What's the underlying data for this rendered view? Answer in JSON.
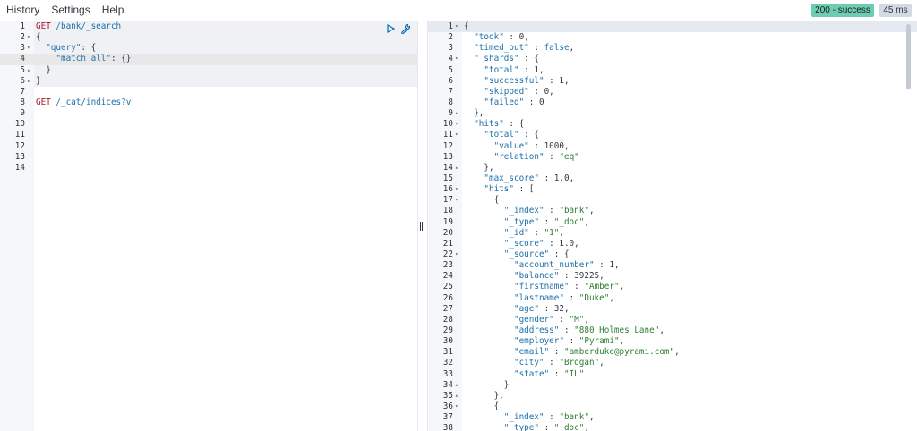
{
  "menu": {
    "history": "History",
    "settings": "Settings",
    "help": "Help"
  },
  "status": {
    "code": "200 - success",
    "time": "45 ms"
  },
  "icons": {
    "run": "play-icon",
    "wrench": "wrench-icon"
  },
  "request": {
    "lines": [
      {
        "n": "1",
        "fold": "",
        "parts": [
          [
            "method",
            "GET"
          ],
          [
            "url",
            " /bank/_search"
          ]
        ]
      },
      {
        "n": "2",
        "fold": "▾",
        "parts": [
          [
            "punc",
            "{"
          ]
        ]
      },
      {
        "n": "3",
        "fold": "▾",
        "parts": [
          [
            "punc",
            "  "
          ],
          [
            "key",
            "\"query\""
          ],
          [
            "punc",
            ": {"
          ]
        ]
      },
      {
        "n": "4",
        "fold": "",
        "parts": [
          [
            "punc",
            "    "
          ],
          [
            "key",
            "\"match_all\""
          ],
          [
            "punc",
            ": {}"
          ]
        ],
        "active": true
      },
      {
        "n": "5",
        "fold": "▴",
        "parts": [
          [
            "punc",
            "  }"
          ]
        ]
      },
      {
        "n": "6",
        "fold": "▴",
        "parts": [
          [
            "punc",
            "}"
          ]
        ]
      },
      {
        "n": "7",
        "fold": "",
        "parts": []
      },
      {
        "n": "8",
        "fold": "",
        "parts": [
          [
            "method",
            "GET"
          ],
          [
            "url",
            " /_cat/indices?v"
          ]
        ]
      },
      {
        "n": "9",
        "fold": "",
        "parts": []
      },
      {
        "n": "10",
        "fold": "",
        "parts": []
      },
      {
        "n": "11",
        "fold": "",
        "parts": []
      },
      {
        "n": "12",
        "fold": "",
        "parts": []
      },
      {
        "n": "13",
        "fold": "",
        "parts": []
      },
      {
        "n": "14",
        "fold": "",
        "parts": []
      }
    ]
  },
  "response": {
    "lines": [
      {
        "n": "1",
        "fold": "▾",
        "parts": [
          [
            "punc",
            "{"
          ]
        ],
        "active": true
      },
      {
        "n": "2",
        "fold": "",
        "parts": [
          [
            "punc",
            "  "
          ],
          [
            "key",
            "\"took\""
          ],
          [
            "punc",
            " : "
          ],
          [
            "num",
            "0"
          ],
          [
            "punc",
            ","
          ]
        ]
      },
      {
        "n": "3",
        "fold": "",
        "parts": [
          [
            "punc",
            "  "
          ],
          [
            "key",
            "\"timed_out\""
          ],
          [
            "punc",
            " : "
          ],
          [
            "bool",
            "false"
          ],
          [
            "punc",
            ","
          ]
        ]
      },
      {
        "n": "4",
        "fold": "▾",
        "parts": [
          [
            "punc",
            "  "
          ],
          [
            "key",
            "\"_shards\""
          ],
          [
            "punc",
            " : {"
          ]
        ]
      },
      {
        "n": "5",
        "fold": "",
        "parts": [
          [
            "punc",
            "    "
          ],
          [
            "key",
            "\"total\""
          ],
          [
            "punc",
            " : "
          ],
          [
            "num",
            "1"
          ],
          [
            "punc",
            ","
          ]
        ]
      },
      {
        "n": "6",
        "fold": "",
        "parts": [
          [
            "punc",
            "    "
          ],
          [
            "key",
            "\"successful\""
          ],
          [
            "punc",
            " : "
          ],
          [
            "num",
            "1"
          ],
          [
            "punc",
            ","
          ]
        ]
      },
      {
        "n": "7",
        "fold": "",
        "parts": [
          [
            "punc",
            "    "
          ],
          [
            "key",
            "\"skipped\""
          ],
          [
            "punc",
            " : "
          ],
          [
            "num",
            "0"
          ],
          [
            "punc",
            ","
          ]
        ]
      },
      {
        "n": "8",
        "fold": "",
        "parts": [
          [
            "punc",
            "    "
          ],
          [
            "key",
            "\"failed\""
          ],
          [
            "punc",
            " : "
          ],
          [
            "num",
            "0"
          ]
        ]
      },
      {
        "n": "9",
        "fold": "▴",
        "parts": [
          [
            "punc",
            "  },"
          ]
        ]
      },
      {
        "n": "10",
        "fold": "▾",
        "parts": [
          [
            "punc",
            "  "
          ],
          [
            "key",
            "\"hits\""
          ],
          [
            "punc",
            " : {"
          ]
        ]
      },
      {
        "n": "11",
        "fold": "▾",
        "parts": [
          [
            "punc",
            "    "
          ],
          [
            "key",
            "\"total\""
          ],
          [
            "punc",
            " : {"
          ]
        ]
      },
      {
        "n": "12",
        "fold": "",
        "parts": [
          [
            "punc",
            "      "
          ],
          [
            "key",
            "\"value\""
          ],
          [
            "punc",
            " : "
          ],
          [
            "num",
            "1000"
          ],
          [
            "punc",
            ","
          ]
        ]
      },
      {
        "n": "13",
        "fold": "",
        "parts": [
          [
            "punc",
            "      "
          ],
          [
            "key",
            "\"relation\""
          ],
          [
            "punc",
            " : "
          ],
          [
            "str",
            "\"eq\""
          ]
        ]
      },
      {
        "n": "14",
        "fold": "▴",
        "parts": [
          [
            "punc",
            "    },"
          ]
        ]
      },
      {
        "n": "15",
        "fold": "",
        "parts": [
          [
            "punc",
            "    "
          ],
          [
            "key",
            "\"max_score\""
          ],
          [
            "punc",
            " : "
          ],
          [
            "num",
            "1.0"
          ],
          [
            "punc",
            ","
          ]
        ]
      },
      {
        "n": "16",
        "fold": "▾",
        "parts": [
          [
            "punc",
            "    "
          ],
          [
            "key",
            "\"hits\""
          ],
          [
            "punc",
            " : ["
          ]
        ]
      },
      {
        "n": "17",
        "fold": "▾",
        "parts": [
          [
            "punc",
            "      {"
          ]
        ]
      },
      {
        "n": "18",
        "fold": "",
        "parts": [
          [
            "punc",
            "        "
          ],
          [
            "key",
            "\"_index\""
          ],
          [
            "punc",
            " : "
          ],
          [
            "str",
            "\"bank\""
          ],
          [
            "punc",
            ","
          ]
        ]
      },
      {
        "n": "19",
        "fold": "",
        "parts": [
          [
            "punc",
            "        "
          ],
          [
            "key",
            "\"_type\""
          ],
          [
            "punc",
            " : "
          ],
          [
            "str",
            "\"_doc\""
          ],
          [
            "punc",
            ","
          ]
        ]
      },
      {
        "n": "20",
        "fold": "",
        "parts": [
          [
            "punc",
            "        "
          ],
          [
            "key",
            "\"_id\""
          ],
          [
            "punc",
            " : "
          ],
          [
            "str",
            "\"1\""
          ],
          [
            "punc",
            ","
          ]
        ]
      },
      {
        "n": "21",
        "fold": "",
        "parts": [
          [
            "punc",
            "        "
          ],
          [
            "key",
            "\"_score\""
          ],
          [
            "punc",
            " : "
          ],
          [
            "num",
            "1.0"
          ],
          [
            "punc",
            ","
          ]
        ]
      },
      {
        "n": "22",
        "fold": "▾",
        "parts": [
          [
            "punc",
            "        "
          ],
          [
            "key",
            "\"_source\""
          ],
          [
            "punc",
            " : {"
          ]
        ]
      },
      {
        "n": "23",
        "fold": "",
        "parts": [
          [
            "punc",
            "          "
          ],
          [
            "key",
            "\"account_number\""
          ],
          [
            "punc",
            " : "
          ],
          [
            "num",
            "1"
          ],
          [
            "punc",
            ","
          ]
        ]
      },
      {
        "n": "24",
        "fold": "",
        "parts": [
          [
            "punc",
            "          "
          ],
          [
            "key",
            "\"balance\""
          ],
          [
            "punc",
            " : "
          ],
          [
            "num",
            "39225"
          ],
          [
            "punc",
            ","
          ]
        ]
      },
      {
        "n": "25",
        "fold": "",
        "parts": [
          [
            "punc",
            "          "
          ],
          [
            "key",
            "\"firstname\""
          ],
          [
            "punc",
            " : "
          ],
          [
            "str",
            "\"Amber\""
          ],
          [
            "punc",
            ","
          ]
        ]
      },
      {
        "n": "26",
        "fold": "",
        "parts": [
          [
            "punc",
            "          "
          ],
          [
            "key",
            "\"lastname\""
          ],
          [
            "punc",
            " : "
          ],
          [
            "str",
            "\"Duke\""
          ],
          [
            "punc",
            ","
          ]
        ]
      },
      {
        "n": "27",
        "fold": "",
        "parts": [
          [
            "punc",
            "          "
          ],
          [
            "key",
            "\"age\""
          ],
          [
            "punc",
            " : "
          ],
          [
            "num",
            "32"
          ],
          [
            "punc",
            ","
          ]
        ]
      },
      {
        "n": "28",
        "fold": "",
        "parts": [
          [
            "punc",
            "          "
          ],
          [
            "key",
            "\"gender\""
          ],
          [
            "punc",
            " : "
          ],
          [
            "str",
            "\"M\""
          ],
          [
            "punc",
            ","
          ]
        ]
      },
      {
        "n": "29",
        "fold": "",
        "parts": [
          [
            "punc",
            "          "
          ],
          [
            "key",
            "\"address\""
          ],
          [
            "punc",
            " : "
          ],
          [
            "str",
            "\"880 Holmes Lane\""
          ],
          [
            "punc",
            ","
          ]
        ]
      },
      {
        "n": "30",
        "fold": "",
        "parts": [
          [
            "punc",
            "          "
          ],
          [
            "key",
            "\"employer\""
          ],
          [
            "punc",
            " : "
          ],
          [
            "str",
            "\"Pyrami\""
          ],
          [
            "punc",
            ","
          ]
        ]
      },
      {
        "n": "31",
        "fold": "",
        "parts": [
          [
            "punc",
            "          "
          ],
          [
            "key",
            "\"email\""
          ],
          [
            "punc",
            " : "
          ],
          [
            "str",
            "\"amberduke@pyrami.com\""
          ],
          [
            "punc",
            ","
          ]
        ]
      },
      {
        "n": "32",
        "fold": "",
        "parts": [
          [
            "punc",
            "          "
          ],
          [
            "key",
            "\"city\""
          ],
          [
            "punc",
            " : "
          ],
          [
            "str",
            "\"Brogan\""
          ],
          [
            "punc",
            ","
          ]
        ]
      },
      {
        "n": "33",
        "fold": "",
        "parts": [
          [
            "punc",
            "          "
          ],
          [
            "key",
            "\"state\""
          ],
          [
            "punc",
            " : "
          ],
          [
            "str",
            "\"IL\""
          ]
        ]
      },
      {
        "n": "34",
        "fold": "▴",
        "parts": [
          [
            "punc",
            "        }"
          ]
        ]
      },
      {
        "n": "35",
        "fold": "▴",
        "parts": [
          [
            "punc",
            "      },"
          ]
        ]
      },
      {
        "n": "36",
        "fold": "▾",
        "parts": [
          [
            "punc",
            "      {"
          ]
        ]
      },
      {
        "n": "37",
        "fold": "",
        "parts": [
          [
            "punc",
            "        "
          ],
          [
            "key",
            "\"_index\""
          ],
          [
            "punc",
            " : "
          ],
          [
            "str",
            "\"bank\""
          ],
          [
            "punc",
            ","
          ]
        ]
      },
      {
        "n": "38",
        "fold": "",
        "parts": [
          [
            "punc",
            "        "
          ],
          [
            "key",
            "\"_type\""
          ],
          [
            "punc",
            " : "
          ],
          [
            "str",
            "\"_doc\""
          ],
          [
            "punc",
            ","
          ]
        ]
      }
    ]
  }
}
